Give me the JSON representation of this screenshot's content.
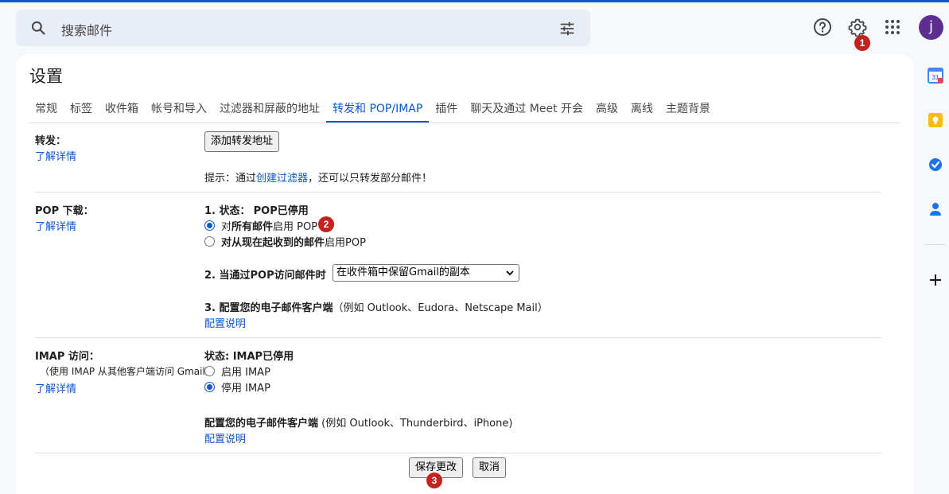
{
  "search": {
    "placeholder": "搜索邮件"
  },
  "header": {
    "avatar_letter": "j"
  },
  "badges": {
    "b1": "1",
    "b2": "2",
    "b3": "3"
  },
  "settings": {
    "title": "设置",
    "tabs": [
      "常规",
      "标签",
      "收件箱",
      "帐号和导入",
      "过滤器和屏蔽的地址",
      "转发和 POP/IMAP",
      "插件",
      "聊天及通过 Meet 开会",
      "高级",
      "离线",
      "主题背景"
    ],
    "active_tab_index": 5
  },
  "forwarding": {
    "label": "转发：",
    "learn_more": "了解详情",
    "add_button": "添加转发地址",
    "tip_prefix": "提示：通过",
    "tip_link": "创建过滤器",
    "tip_suffix": "，还可以只转发部分邮件！"
  },
  "pop": {
    "label": "POP 下载：",
    "learn_more": "了解详情",
    "status_prefix": "1. 状态：",
    "status_value": "POP已停用",
    "opt1_pre": "对",
    "opt1_bold": "所有邮件",
    "opt1_post": "启用 POP",
    "opt2_bold": "对从现在起收到的邮件",
    "opt2_post": "启用POP",
    "access_label": "2. 当通过POP访问邮件时",
    "access_select": "在收件箱中保留Gmail的副本",
    "config_bold": "3. 配置您的电子邮件客户端",
    "config_note": "（例如 Outlook、Eudora、Netscape Mail）",
    "config_link": "配置说明"
  },
  "imap": {
    "label": "IMAP 访问：",
    "sub": "（使用 IMAP 从其他客户端访问 Gmail）",
    "learn_more": "了解详情",
    "status": "状态: IMAP已停用",
    "enable": "启用 IMAP",
    "disable": "停用 IMAP",
    "config_bold": "配置您的电子邮件客户端",
    "config_note": " (例如 Outlook、Thunderbird、iPhone)",
    "config_link": "配置说明"
  },
  "footer": {
    "save": "保存更改",
    "cancel": "取消"
  },
  "colors": {
    "accent": "#0b57d0",
    "badge": "#c5221f",
    "avatar": "#5e2d91"
  }
}
